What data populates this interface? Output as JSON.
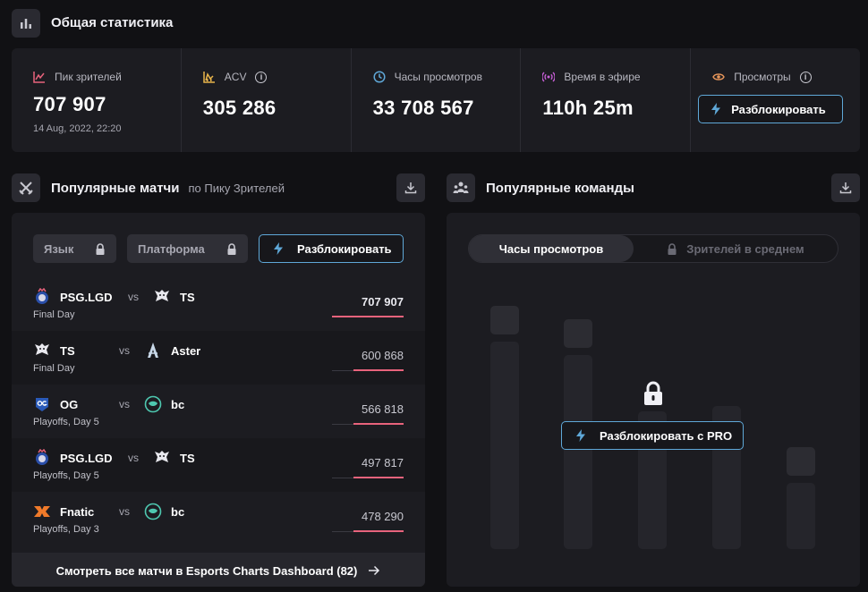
{
  "general": {
    "title": "Общая статистика"
  },
  "stats": [
    {
      "label": "Пик зрителей",
      "value": "707 907",
      "sub": "14 Aug, 2022, 22:20",
      "icon": "peak-chart-icon",
      "color": "#e8637c"
    },
    {
      "label": "ACV",
      "value": "305 286",
      "icon": "acv-chart-icon",
      "color": "#e8b44a",
      "info": "i"
    },
    {
      "label": "Часы просмотров",
      "value": "33 708 567",
      "icon": "clock-icon",
      "color": "#5fa8d8"
    },
    {
      "label": "Время в эфире",
      "value": "110h 25m",
      "icon": "broadcast-icon",
      "color": "#c85fd8"
    },
    {
      "label": "Просмотры",
      "icon": "eye-icon",
      "color": "#e8965a",
      "info": "i",
      "button": "Разблокировать"
    }
  ],
  "matches": {
    "title": "Популярные матчи",
    "subtitle": "по Пику Зрителей",
    "filters": {
      "language": "Язык",
      "platform": "Платформа",
      "unlock": "Разблокировать"
    },
    "vs_label": "vs",
    "rows": [
      {
        "team1": "PSG.LGD",
        "team2": "TS",
        "stage": "Final Day",
        "value": "707 907",
        "share": 1.0
      },
      {
        "team1": "TS",
        "team2": "Aster",
        "stage": "Final Day",
        "value": "600 868",
        "share": 0.849
      },
      {
        "team1": "OG",
        "team2": "bc",
        "stage": "Playoffs, Day 5",
        "value": "566 818",
        "share": 0.8
      },
      {
        "team1": "PSG.LGD",
        "team2": "TS",
        "stage": "Playoffs, Day 5",
        "value": "497 817",
        "share": 0.703
      },
      {
        "team1": "Fnatic",
        "team2": "bc",
        "stage": "Playoffs, Day 3",
        "value": "478 290",
        "share": 0.676
      }
    ],
    "footer": "Смотреть все матчи в Esports Charts Dashboard (82)"
  },
  "teams": {
    "title": "Популярные команды",
    "tab_active": "Часы просмотров",
    "tab_locked": "Зрителей в среднем",
    "unlock": "Разблокировать с PRO"
  }
}
